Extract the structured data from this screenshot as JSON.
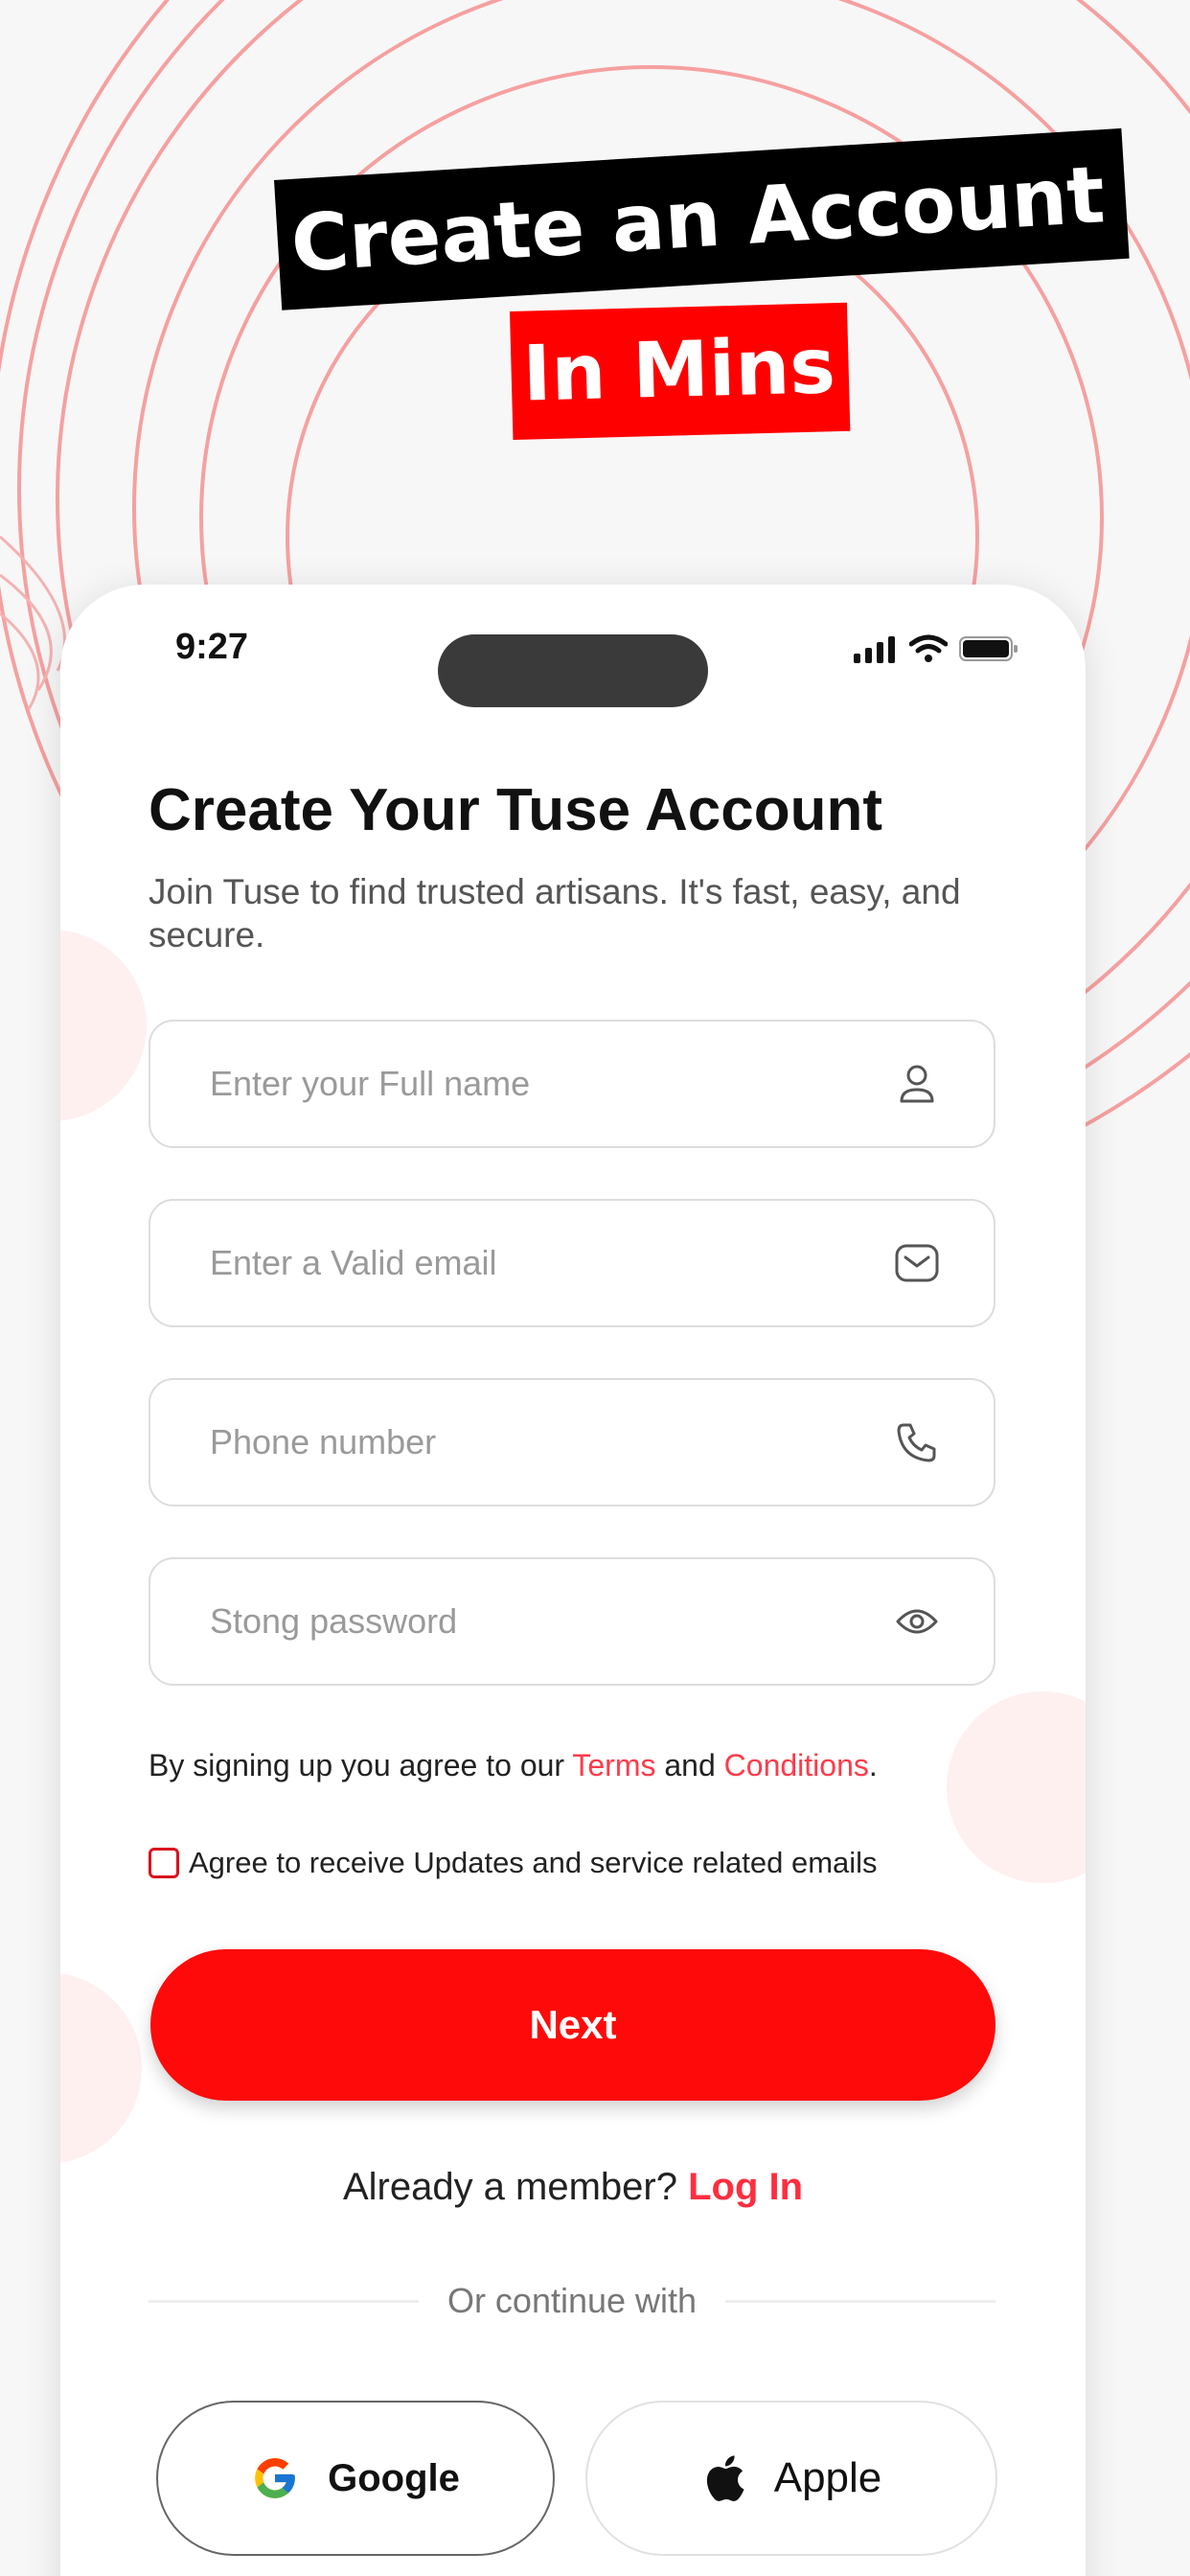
{
  "promo": {
    "headline_line1": "Create an Account",
    "headline_line2": "In Mins"
  },
  "status_bar": {
    "time": "9:27"
  },
  "form": {
    "title": "Create Your Tuse Account",
    "subtitle": "Join Tuse to find trusted artisans. It's fast, easy, and secure.",
    "fields": [
      {
        "placeholder": "Enter your Full name",
        "icon": "user-icon"
      },
      {
        "placeholder": "Enter a Valid email",
        "icon": "mail-icon"
      },
      {
        "placeholder": "Phone number",
        "icon": "phone-icon"
      },
      {
        "placeholder": "Stong password",
        "icon": "eye-icon"
      }
    ],
    "terms": {
      "prefix": "By signing up you agree to our ",
      "terms_link": "Terms",
      "middle": " and ",
      "conditions_link": "Conditions",
      "suffix": "."
    },
    "updates_checkbox_label": "Agree to receive Updates and service related emails",
    "updates_checked": false,
    "next_label": "Next",
    "member_prefix": "Already a member? ",
    "login_label": "Log In",
    "divider_text": "Or continue with",
    "google_label": "Google",
    "apple_label": "Apple"
  },
  "colors": {
    "brand_red": "#ff0a0a",
    "link_red": "#ff3b4a",
    "headline_black": "#000000"
  }
}
